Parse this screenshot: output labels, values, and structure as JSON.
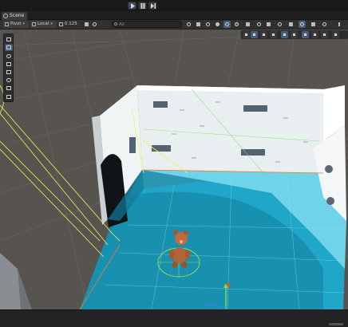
{
  "playbar": {
    "buttons": [
      "play",
      "pause",
      "step"
    ]
  },
  "tab": {
    "label": "Scene",
    "icon": "scene-icon"
  },
  "toolbar": {
    "pivot_label": "Pivot",
    "space_label": "Local",
    "snap_value": "0.125",
    "search_placeholder": "All",
    "icons": [
      "layers-icon",
      "grid-icon",
      "shading-icon",
      "lighting-icon",
      "audio-icon",
      "effects-icon",
      "gizmos-icon",
      "camera-icon"
    ]
  },
  "overlay": {
    "icons": [
      "move-icon",
      "rotate-icon",
      "scale-icon",
      "rect-icon",
      "transform-icon",
      "lighting-icon",
      "audio-icon",
      "fx-icon",
      "gizmo-icon",
      "camera-icon"
    ]
  },
  "palette": {
    "tools": [
      "view-tool",
      "move-tool",
      "rotate-tool",
      "scale-tool",
      "rect-tool",
      "transform-tool",
      "custom-tool",
      "extra-tool"
    ]
  },
  "colors": {
    "floor": "#1fa6c9",
    "floor_light": "#7fe0f2",
    "wall": "#e9eef0",
    "bg": "#57534f",
    "selection": "#f4f15a",
    "accent_orange": "#f07a2c"
  }
}
